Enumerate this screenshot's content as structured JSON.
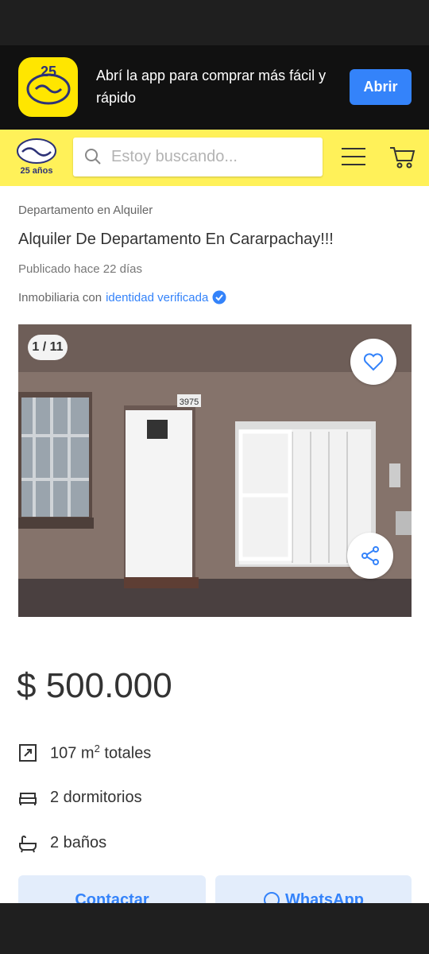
{
  "app_banner": {
    "text": "Abrí la app para comprar más fácil y rápido",
    "open_label": "Abrir",
    "logo_text": "25"
  },
  "header": {
    "logo_caption": "25 años",
    "search_placeholder": "Estoy buscando...",
    "accent_color": "#fff159"
  },
  "listing": {
    "category": "Departamento en Alquiler",
    "title": "Alquiler De Departamento En Cararpachay!!!",
    "published": "Publicado hace 22 días",
    "seller_prefix": "Inmobiliaria con",
    "seller_verified": "identidad verificada",
    "photo_counter": "1 / 11",
    "house_number": "3975",
    "price": "$ 500.000",
    "features": {
      "area_number": "107 m",
      "area_sup": "2",
      "area_suffix": " totales",
      "bedrooms": "2 dormitorios",
      "bathrooms": "2 baños"
    }
  },
  "actions": {
    "contact_label": "Contactar",
    "whatsapp_label": "WhatsApp"
  },
  "colors": {
    "brand_blue": "#3483fa",
    "brand_yellow": "#ffe600"
  }
}
